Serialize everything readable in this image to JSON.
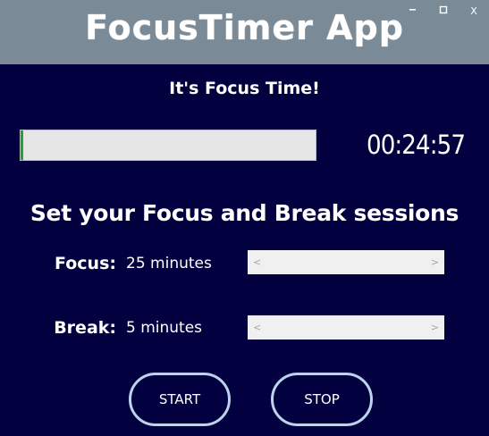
{
  "window": {
    "title": "FocusTimer App",
    "controls": {
      "minimize_icon": "minimize-icon",
      "maximize_icon": "maximize-icon",
      "close_label": "X"
    }
  },
  "status": {
    "text": "It's Focus Time!"
  },
  "timer": {
    "progress_fraction": 0.01,
    "remaining": "00:24:57"
  },
  "settings": {
    "heading": "Set your Focus and Break sessions",
    "focus": {
      "label": "Focus:",
      "value": "25 minutes"
    },
    "break": {
      "label": "Break:",
      "value": "5 minutes"
    },
    "slider_arrows": {
      "left": "<",
      "right": ">"
    }
  },
  "buttons": {
    "start_label": "START",
    "stop_label": "STOP"
  },
  "colors": {
    "background": "#02003f",
    "titlebar": "#7a8a96",
    "progress_fill": "#1fa33c",
    "button_border": "#bcd3ee"
  }
}
